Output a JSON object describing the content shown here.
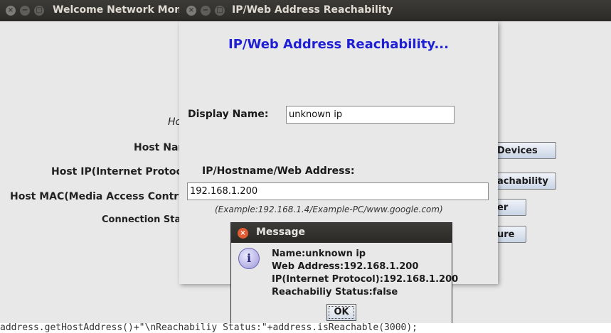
{
  "main_window": {
    "title": "Welcome Network Monit",
    "labels": {
      "host_name": "Host Nar",
      "host_ip": "Host IP(Internet Protoc",
      "host_mac": "Host MAC(Media Access Contr",
      "connection_status": "Connection Stat",
      "partial_italic": "Ho"
    },
    "buttons": {
      "devices": "Devices",
      "reachability": "achability",
      "third": "er",
      "fourth": "ure"
    }
  },
  "ip_dialog": {
    "title": "IP/Web Address Reachability",
    "heading": "IP/Web Address Reachability...",
    "display_name_label": "Display Name:",
    "display_name_value": "unknown ip",
    "address_label": "IP/Hostname/Web Address:",
    "address_value": "192.168.1.200",
    "example_hint": "(Example:192.168.1.4/Example-PC/www.google.com)"
  },
  "message_box": {
    "title": "Message",
    "icon": "info-icon",
    "icon_glyph": "i",
    "lines": [
      "Name:unknown ip",
      "Web Address:192.168.1.200",
      "IP(Internet Protocol):192.168.1.200",
      "Reachabiliy Status:false"
    ],
    "ok_label": "OK"
  },
  "code_strip": {
    "text": "address.getHostAddress()+\"\\nReachabiliy Status:\"+address.isReachable(3000);"
  },
  "colors": {
    "titlebar": "#3c3b37",
    "heading_blue": "#1f1fd6",
    "window_bg": "#e8e8e8",
    "close_orange": "#e25c33"
  }
}
